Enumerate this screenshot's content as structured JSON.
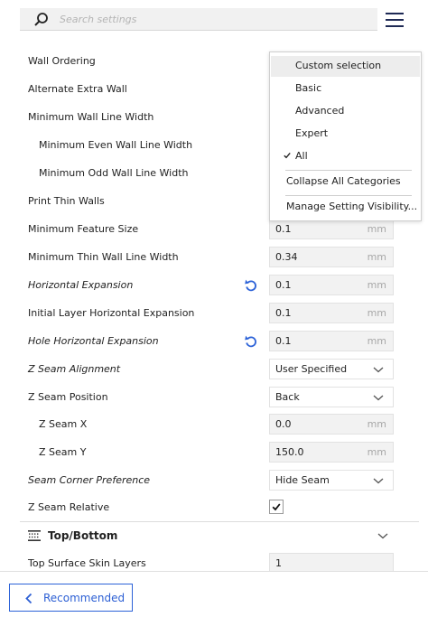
{
  "search": {
    "placeholder": "Search settings"
  },
  "settings": [
    {
      "label": "Wall Ordering"
    },
    {
      "label": "Alternate Extra Wall"
    },
    {
      "label": "Minimum Wall Line Width"
    },
    {
      "label": "Minimum Even Wall Line Width"
    },
    {
      "label": "Minimum Odd Wall Line Width"
    },
    {
      "label": "Print Thin Walls"
    },
    {
      "label": "Minimum Feature Size",
      "value": "0.1",
      "unit": "mm"
    },
    {
      "label": "Minimum Thin Wall Line Width",
      "value": "0.34",
      "unit": "mm"
    },
    {
      "label": "Horizontal Expansion",
      "value": "0.1",
      "unit": "mm"
    },
    {
      "label": "Initial Layer Horizontal Expansion",
      "value": "0.1",
      "unit": "mm"
    },
    {
      "label": "Hole Horizontal Expansion",
      "value": "0.1",
      "unit": "mm"
    },
    {
      "label": "Z Seam Alignment",
      "value": "User Specified"
    },
    {
      "label": "Z Seam Position",
      "value": "Back"
    },
    {
      "label": "Z Seam X",
      "value": "0.0",
      "unit": "mm"
    },
    {
      "label": "Z Seam Y",
      "value": "150.0",
      "unit": "mm"
    },
    {
      "label": "Seam Corner Preference",
      "value": "Hide Seam"
    },
    {
      "label": "Z Seam Relative",
      "checked": true
    }
  ],
  "category": {
    "title": "Top/Bottom"
  },
  "partial_setting": {
    "label": "Top Surface Skin Layers",
    "value": "1"
  },
  "visibility_menu": {
    "items": [
      "Custom selection",
      "Basic",
      "Advanced",
      "Expert",
      "All"
    ],
    "highlighted": "Custom selection",
    "checked": "All",
    "actions": [
      "Collapse All Categories",
      "Manage Setting Visibility..."
    ]
  },
  "bottom": {
    "recommended_label": "Recommended"
  },
  "colors": {
    "accent": "#2c62d8",
    "menu_icon": "#1f2a55",
    "reset_icon": "#2c62d8"
  }
}
